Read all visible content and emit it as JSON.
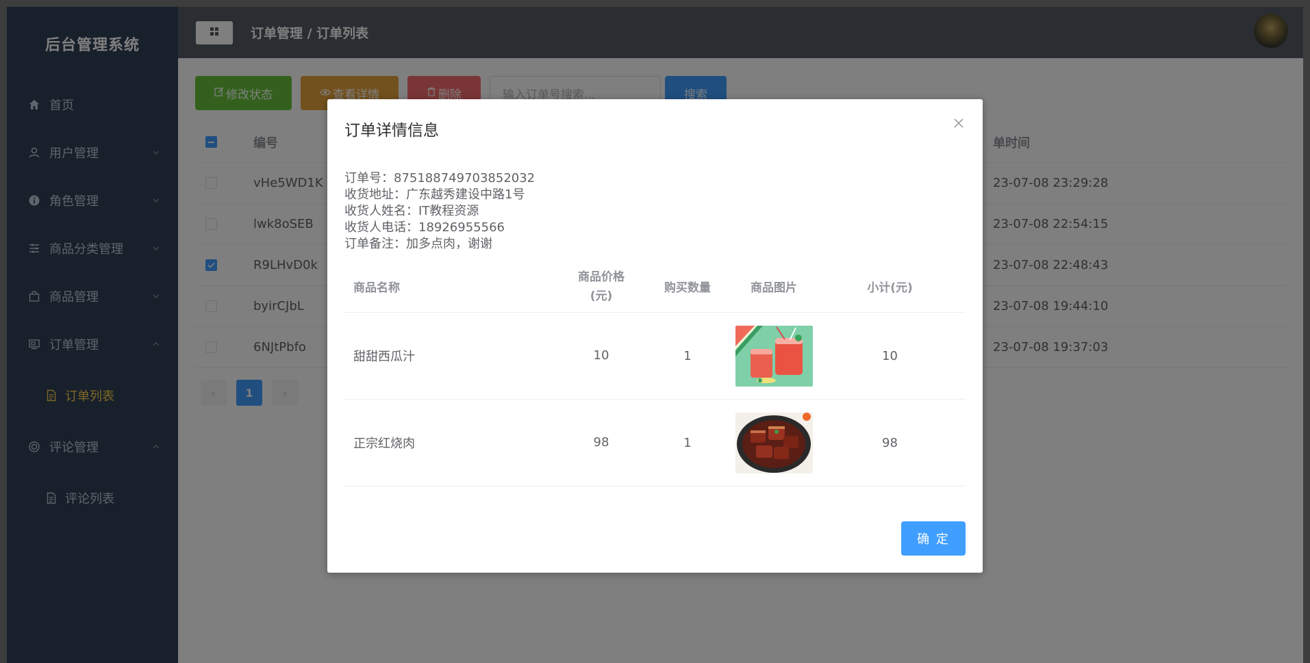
{
  "sidebar": {
    "brand": "后台管理系统",
    "items": [
      {
        "label": "首页",
        "icon": "home-icon"
      },
      {
        "label": "用户管理",
        "icon": "user-icon"
      },
      {
        "label": "角色管理",
        "icon": "info-icon"
      },
      {
        "label": "商品分类管理",
        "icon": "sliders-icon"
      },
      {
        "label": "商品管理",
        "icon": "bag-icon"
      },
      {
        "label": "订单管理",
        "icon": "monitor-icon"
      },
      {
        "label": "评论管理",
        "icon": "circle-icon"
      }
    ],
    "sub_order": "订单列表",
    "sub_comment": "评论列表"
  },
  "header": {
    "breadcrumb": "订单管理 / 订单列表"
  },
  "toolbar": {
    "edit_status": "修改状态",
    "view_detail": "查看详情",
    "delete": "删除",
    "search_placeholder": "输入订单号搜索...",
    "search": "搜索"
  },
  "table": {
    "col_id": "编号",
    "col_time": "单时间",
    "rows": [
      {
        "id": "vHe5WD1K",
        "time": "23-07-08 23:29:28",
        "checked": false
      },
      {
        "id": "lwk8oSEB",
        "time": "23-07-08 22:54:15",
        "checked": false
      },
      {
        "id": "R9LHvD0k",
        "time": "23-07-08 22:48:43",
        "checked": true
      },
      {
        "id": "byirCJbL",
        "time": "23-07-08 19:44:10",
        "checked": false
      },
      {
        "id": "6NJtPbfo",
        "time": "23-07-08 19:37:03",
        "checked": false
      }
    ]
  },
  "pager": {
    "prev": "‹",
    "page": "1",
    "next": "›"
  },
  "dialog": {
    "title": "订单详情信息",
    "order_no": "订单号：875188749703852032",
    "address": "收货地址：广东越秀建设中路1号",
    "receiver": "收货人姓名：IT教程资源",
    "phone": "收货人电话：18926955566",
    "remark": "订单备注：加多点肉，谢谢",
    "headers": {
      "name": "商品名称",
      "price_line1": "商品价格",
      "price_line2": "(元)",
      "qty": "购买数量",
      "image": "商品图片",
      "subtotal": "小计(元)"
    },
    "items": [
      {
        "name": "甜甜西瓜汁",
        "price": "10",
        "qty": "1",
        "subtotal": "10"
      },
      {
        "name": "正宗红烧肉",
        "price": "98",
        "qty": "1",
        "subtotal": "98"
      }
    ],
    "ok": "确 定"
  },
  "colors": {
    "sidebar_bg": "#304156",
    "header_bg": "#545c64",
    "active_menu": "#ffd04b",
    "primary": "#409eff",
    "success": "#67c23a",
    "warning": "#e6a23c",
    "danger": "#f56c6c"
  }
}
